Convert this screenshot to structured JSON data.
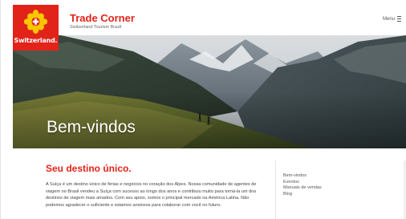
{
  "brand": {
    "logo_text": "Switzerland.",
    "title": "Trade Corner",
    "subtitle": "Switzerland Tourism Brazil"
  },
  "header": {
    "menu_label": "Menu"
  },
  "hero": {
    "title": "Bem-vindos"
  },
  "main": {
    "heading": "Seu destino único.",
    "paragraph": "A Suíça é um destino único de férias e negócios no coração dos Alpes. Nossa comunidade de agentes de viagem no Brasil vendeu a Suíça com sucesso ao longo dos anos e contribuiu muito para torná-la um dos destinos de viagem mais amados. Com seu apoio, somos o principal mercado na América Latina. Não podemos agradecer o suficiente e estamos ansiosos para colaborar com você no futuro."
  },
  "side_nav": {
    "items": [
      {
        "label": "Bem-vindos"
      },
      {
        "label": "Eventos"
      },
      {
        "label": "Manuais de vendas"
      },
      {
        "label": "Blog"
      }
    ]
  },
  "colors": {
    "brand_red": "#e2231a"
  },
  "icons": {
    "logo": "swiss-cross-flower-icon",
    "menu": "hamburger-icon"
  }
}
